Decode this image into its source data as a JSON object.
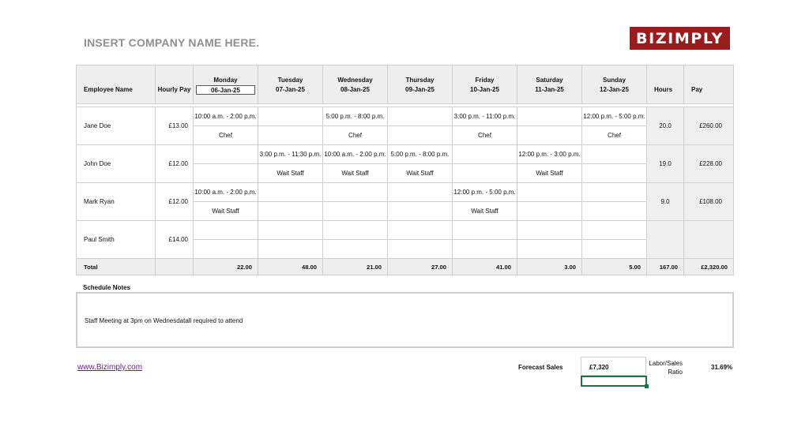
{
  "company": "INSERT COMPANY NAME HERE.",
  "logo_text": "BIZIMPLY",
  "header": {
    "employee_name": "Employee Name",
    "hourly_pay": "Hourly Pay",
    "days": [
      {
        "name": "Monday",
        "date": "06-Jan-25"
      },
      {
        "name": "Tuesday",
        "date": "07-Jan-25"
      },
      {
        "name": "Wednesday",
        "date": "08-Jan-25"
      },
      {
        "name": "Thursday",
        "date": "09-Jan-25"
      },
      {
        "name": "Friday",
        "date": "10-Jan-25"
      },
      {
        "name": "Saturday",
        "date": "11-Jan-25"
      },
      {
        "name": "Sunday",
        "date": "12-Jan-25"
      }
    ],
    "hours": "Hours",
    "pay": "Pay"
  },
  "employees": [
    {
      "name": "Jane Doe",
      "rate": "£13.00",
      "hours": "20.0",
      "pay": "£260.00",
      "times": [
        "10:00 a.m. - 2:00 p.m.",
        "",
        "5:00 p.m. - 8:00 p.m.",
        "",
        "3:00 p.m. - 11:00 p.m.",
        "",
        "12:00 p.m. - 5:00 p.m."
      ],
      "roles": [
        "Chef",
        "",
        "Chef",
        "",
        "Chef",
        "",
        "Chef"
      ]
    },
    {
      "name": "John Doe",
      "rate": "£12.00",
      "hours": "19.0",
      "pay": "£228.00",
      "times": [
        "",
        "3:00 p.m. - 11:30 p.m.",
        "10:00 a.m. - 2:00 p.m.",
        "5:00 p.m. - 8:00 p.m.",
        "",
        "12:00 p.m. - 3:00 p.m.",
        ""
      ],
      "roles": [
        "",
        "Wait Staff",
        "Wait Staff",
        "Wait Staff",
        "",
        "Wait Staff",
        ""
      ]
    },
    {
      "name": "Mark Ryan",
      "rate": "£12.00",
      "hours": "9.0",
      "pay": "£108.00",
      "times": [
        "10:00 a.m. - 2:00 p.m.",
        "",
        "",
        "",
        "12:00 p.m. - 5:00 p.m.",
        "",
        ""
      ],
      "roles": [
        "Wait Staff",
        "",
        "",
        "",
        "Wait Staff",
        "",
        ""
      ]
    },
    {
      "name": "Paul Smith",
      "rate": "£14.00",
      "hours": "",
      "pay": "",
      "times": [
        "",
        "",
        "",
        "",
        "",
        "",
        ""
      ],
      "roles": [
        "",
        "",
        "",
        "",
        "",
        "",
        ""
      ]
    }
  ],
  "totals": {
    "label": "Total",
    "days": [
      "22.00",
      "48.00",
      "21.00",
      "27.00",
      "41.00",
      "3.00",
      "5.00"
    ],
    "hours": "167.00",
    "pay": "£2,320.00"
  },
  "notes": {
    "title": "Schedule Notes",
    "text": "Staff Meeting at 3pm  on Wednesdatall required to attend"
  },
  "website": "www.Bizimply.com",
  "forecast": {
    "label": "Forecast Sales",
    "value": "£7,320",
    "ratio_label_line1": "Labor/Sales",
    "ratio_label_line2": "Ratio",
    "ratio_value": "31.69%"
  },
  "colors": {
    "logo_bg": "#9b1c1c",
    "header_bg": "#eeeeee",
    "link": "#6b1e8e",
    "selection": "#1e7145"
  }
}
